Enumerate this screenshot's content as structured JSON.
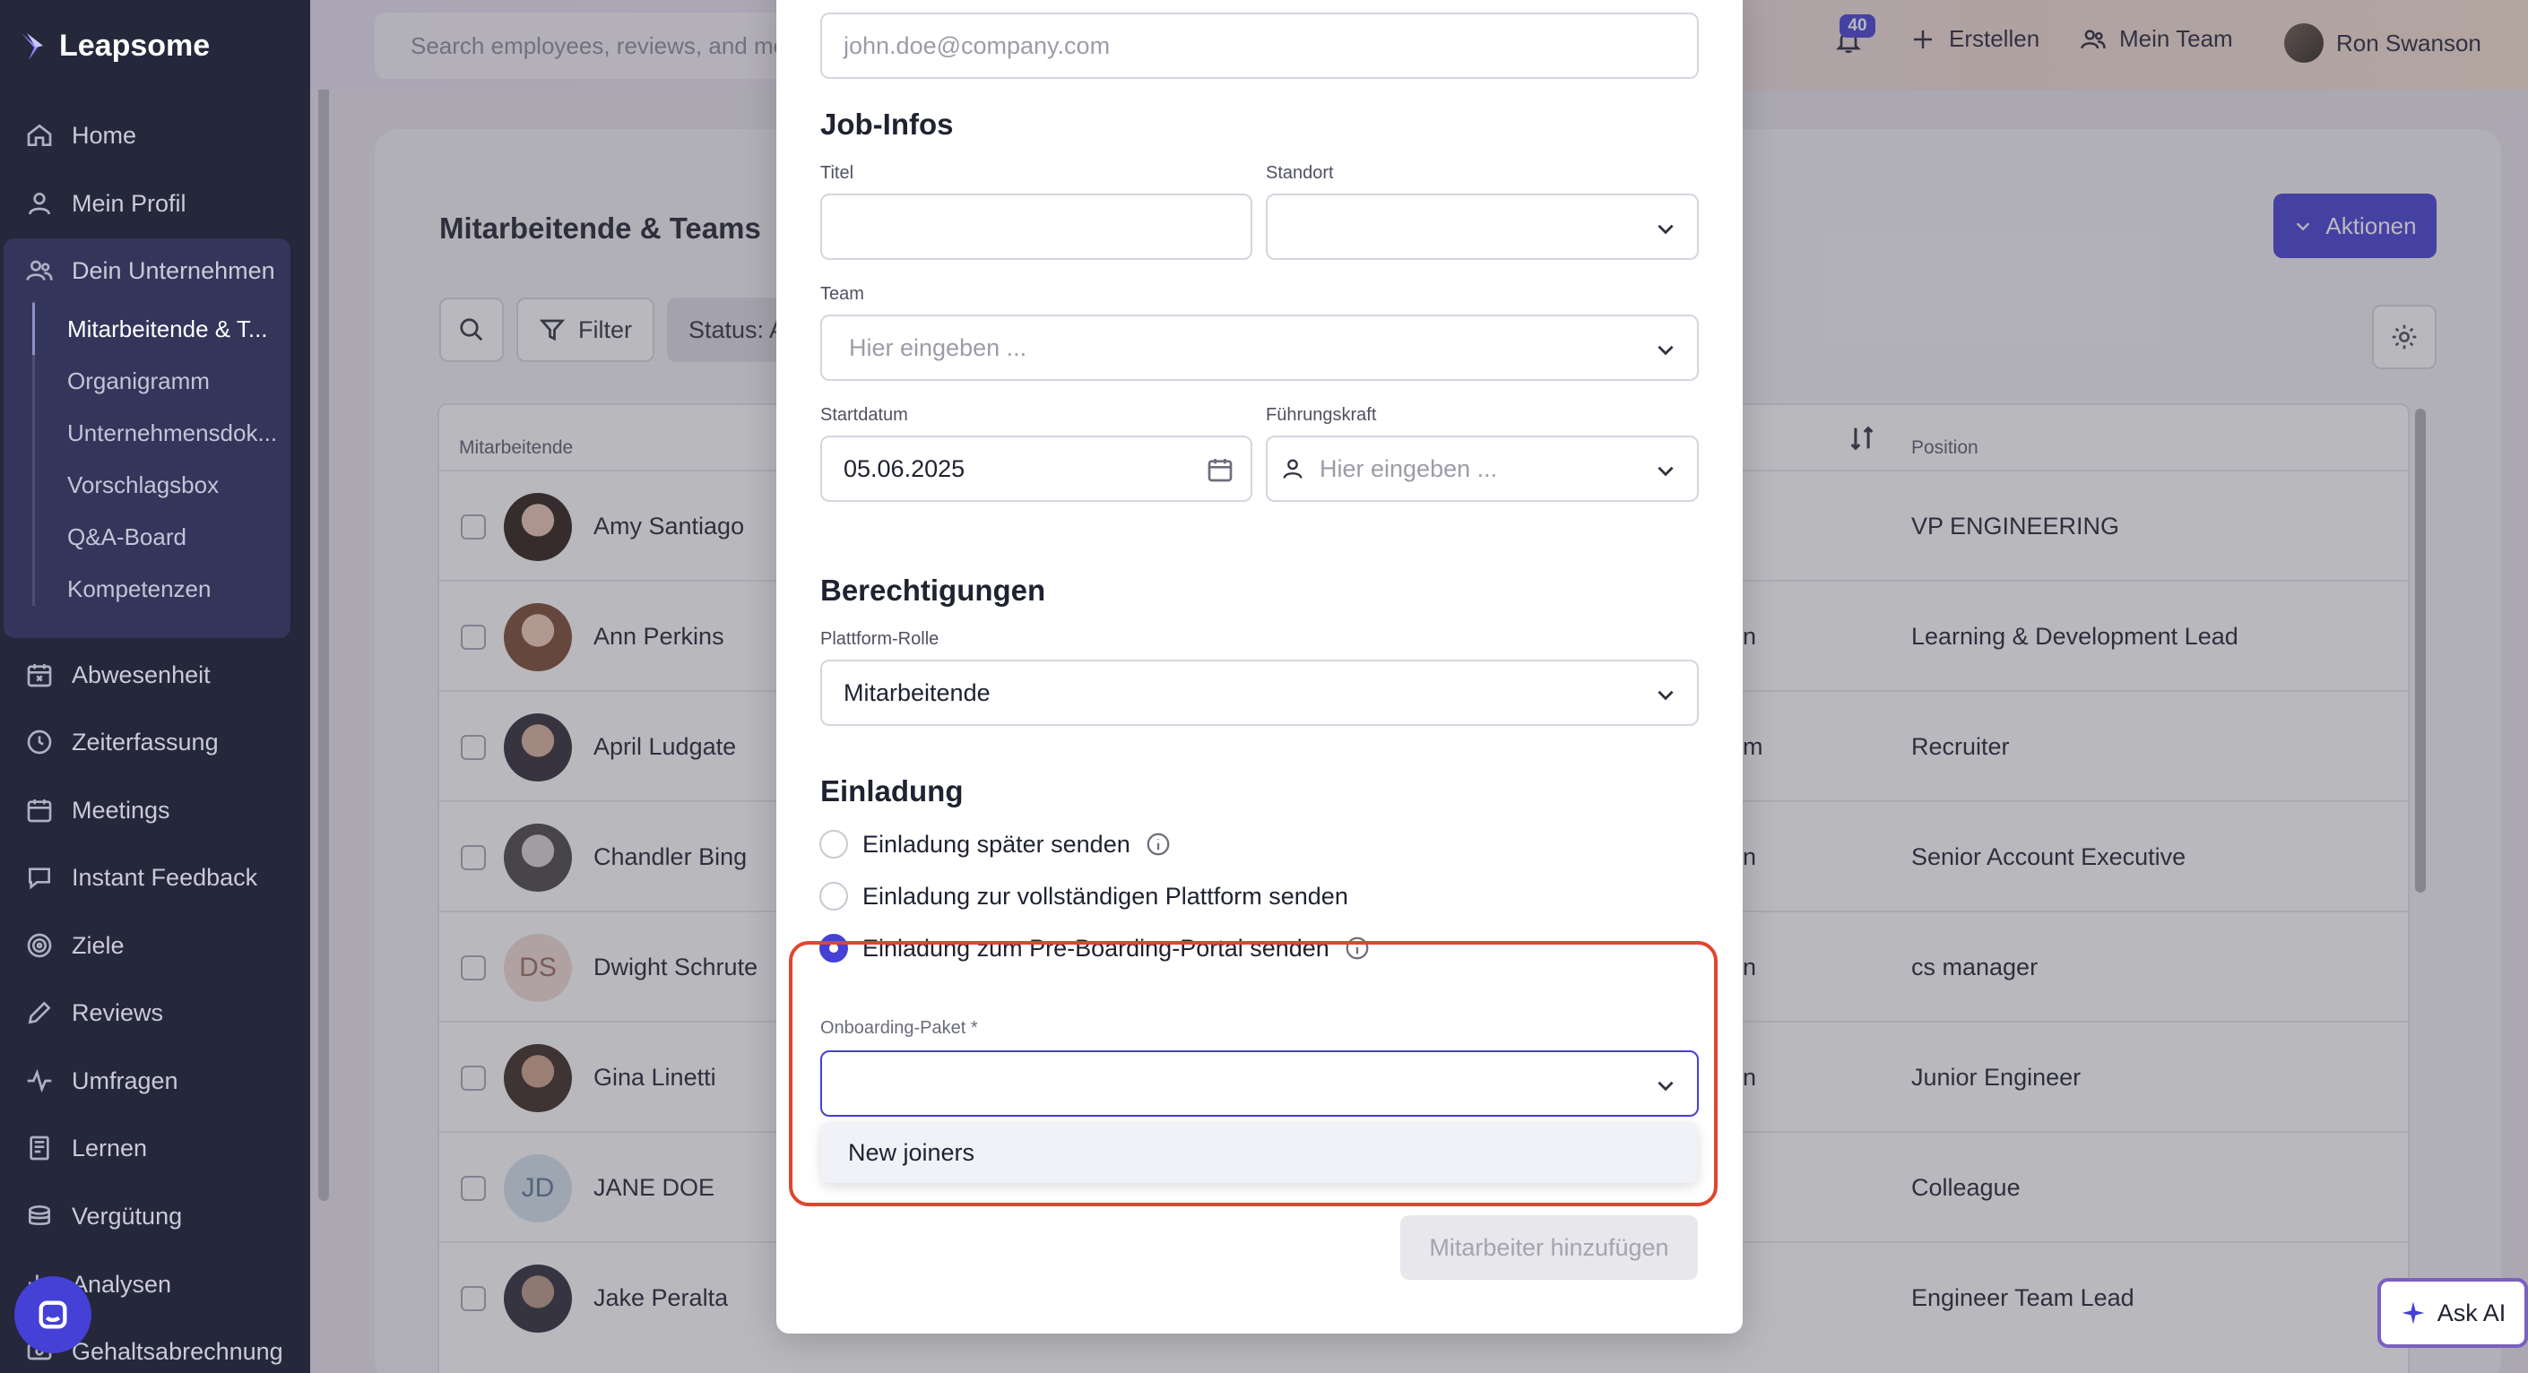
{
  "app": {
    "name": "Leapsome"
  },
  "sidebar": {
    "items": [
      {
        "label": "Home",
        "icon": "home-icon"
      },
      {
        "label": "Mein Profil",
        "icon": "user-icon"
      },
      {
        "label": "Dein Unternehmen",
        "icon": "people-icon"
      },
      {
        "label": "Abwesenheit",
        "icon": "calendar-x-icon"
      },
      {
        "label": "Zeiterfassung",
        "icon": "clock-icon"
      },
      {
        "label": "Meetings",
        "icon": "calendar-icon"
      },
      {
        "label": "Instant Feedback",
        "icon": "chat-icon"
      },
      {
        "label": "Ziele",
        "icon": "target-icon"
      },
      {
        "label": "Reviews",
        "icon": "pen-icon"
      },
      {
        "label": "Umfragen",
        "icon": "pulse-icon"
      },
      {
        "label": "Lernen",
        "icon": "book-icon"
      },
      {
        "label": "Vergütung",
        "icon": "coins-icon"
      },
      {
        "label": "Analysen",
        "icon": "chart-icon"
      },
      {
        "label": "Gehaltsabrechnung",
        "icon": "payroll-icon"
      }
    ],
    "subitems": [
      {
        "label": "Mitarbeitende & T..."
      },
      {
        "label": "Organigramm"
      },
      {
        "label": "Unternehmensdok..."
      },
      {
        "label": "Vorschlagsbox"
      },
      {
        "label": "Q&A-Board"
      },
      {
        "label": "Kompetenzen"
      }
    ]
  },
  "topbar": {
    "search_placeholder": "Search employees, reviews, and more",
    "notification_count": "40",
    "create_label": "Erstellen",
    "team_label": "Mein Team",
    "user_name": "Ron Swanson"
  },
  "page": {
    "title": "Mitarbeitende & Teams",
    "actions_label": "Aktionen",
    "filter_label": "Filter",
    "status_label": "Status: A"
  },
  "table": {
    "col_employee": "Mitarbeitende",
    "col_position": "Position",
    "rows": [
      {
        "name": "Amy Santiago",
        "position": "VP ENGINEERING",
        "frag": "",
        "initials": ""
      },
      {
        "name": "Ann Perkins",
        "position": "Learning & Development Lead",
        "frag": "n",
        "initials": ""
      },
      {
        "name": "April Ludgate",
        "position": "Recruiter",
        "frag": "m",
        "initials": ""
      },
      {
        "name": "Chandler Bing",
        "position": "Senior Account Executive",
        "frag": "n",
        "initials": ""
      },
      {
        "name": "Dwight Schrute",
        "position": "cs manager",
        "frag": "n",
        "initials": "DS"
      },
      {
        "name": "Gina Linetti",
        "position": "Junior Engineer",
        "frag": "n",
        "initials": ""
      },
      {
        "name": "JANE DOE",
        "position": "Colleague",
        "frag": "",
        "initials": "JD"
      },
      {
        "name": "Jake Peralta",
        "position": "Engineer Team Lead",
        "frag": "",
        "initials": ""
      }
    ]
  },
  "modal": {
    "email_placeholder": "john.doe@company.com",
    "job_section": "Job-Infos",
    "title_label": "Titel",
    "location_label": "Standort",
    "team_label": "Team",
    "team_placeholder": "Hier eingeben ...",
    "start_label": "Startdatum",
    "start_value": "05.06.2025",
    "manager_label": "Führungskraft",
    "manager_placeholder": "Hier eingeben ...",
    "perm_section": "Berechtigungen",
    "role_label": "Plattform-Rolle",
    "role_value": "Mitarbeitende",
    "invite_section": "Einladung",
    "invite_options": [
      {
        "label": "Einladung später senden",
        "selected": false,
        "info": true
      },
      {
        "label": "Einladung zur vollständigen Plattform senden",
        "selected": false,
        "info": false
      },
      {
        "label": "Einladung zum Pre-Boarding-Portal senden",
        "selected": true,
        "info": true
      }
    ],
    "package_label": "Onboarding-Paket *",
    "package_value": "",
    "package_options": [
      "New joiners"
    ],
    "submit_label": "Mitarbeiter hinzufügen"
  },
  "ask_ai_label": "Ask AI",
  "colors": {
    "accent": "#4540d6",
    "sidebar_bg": "#25273a",
    "highlight": "#e0452f"
  }
}
